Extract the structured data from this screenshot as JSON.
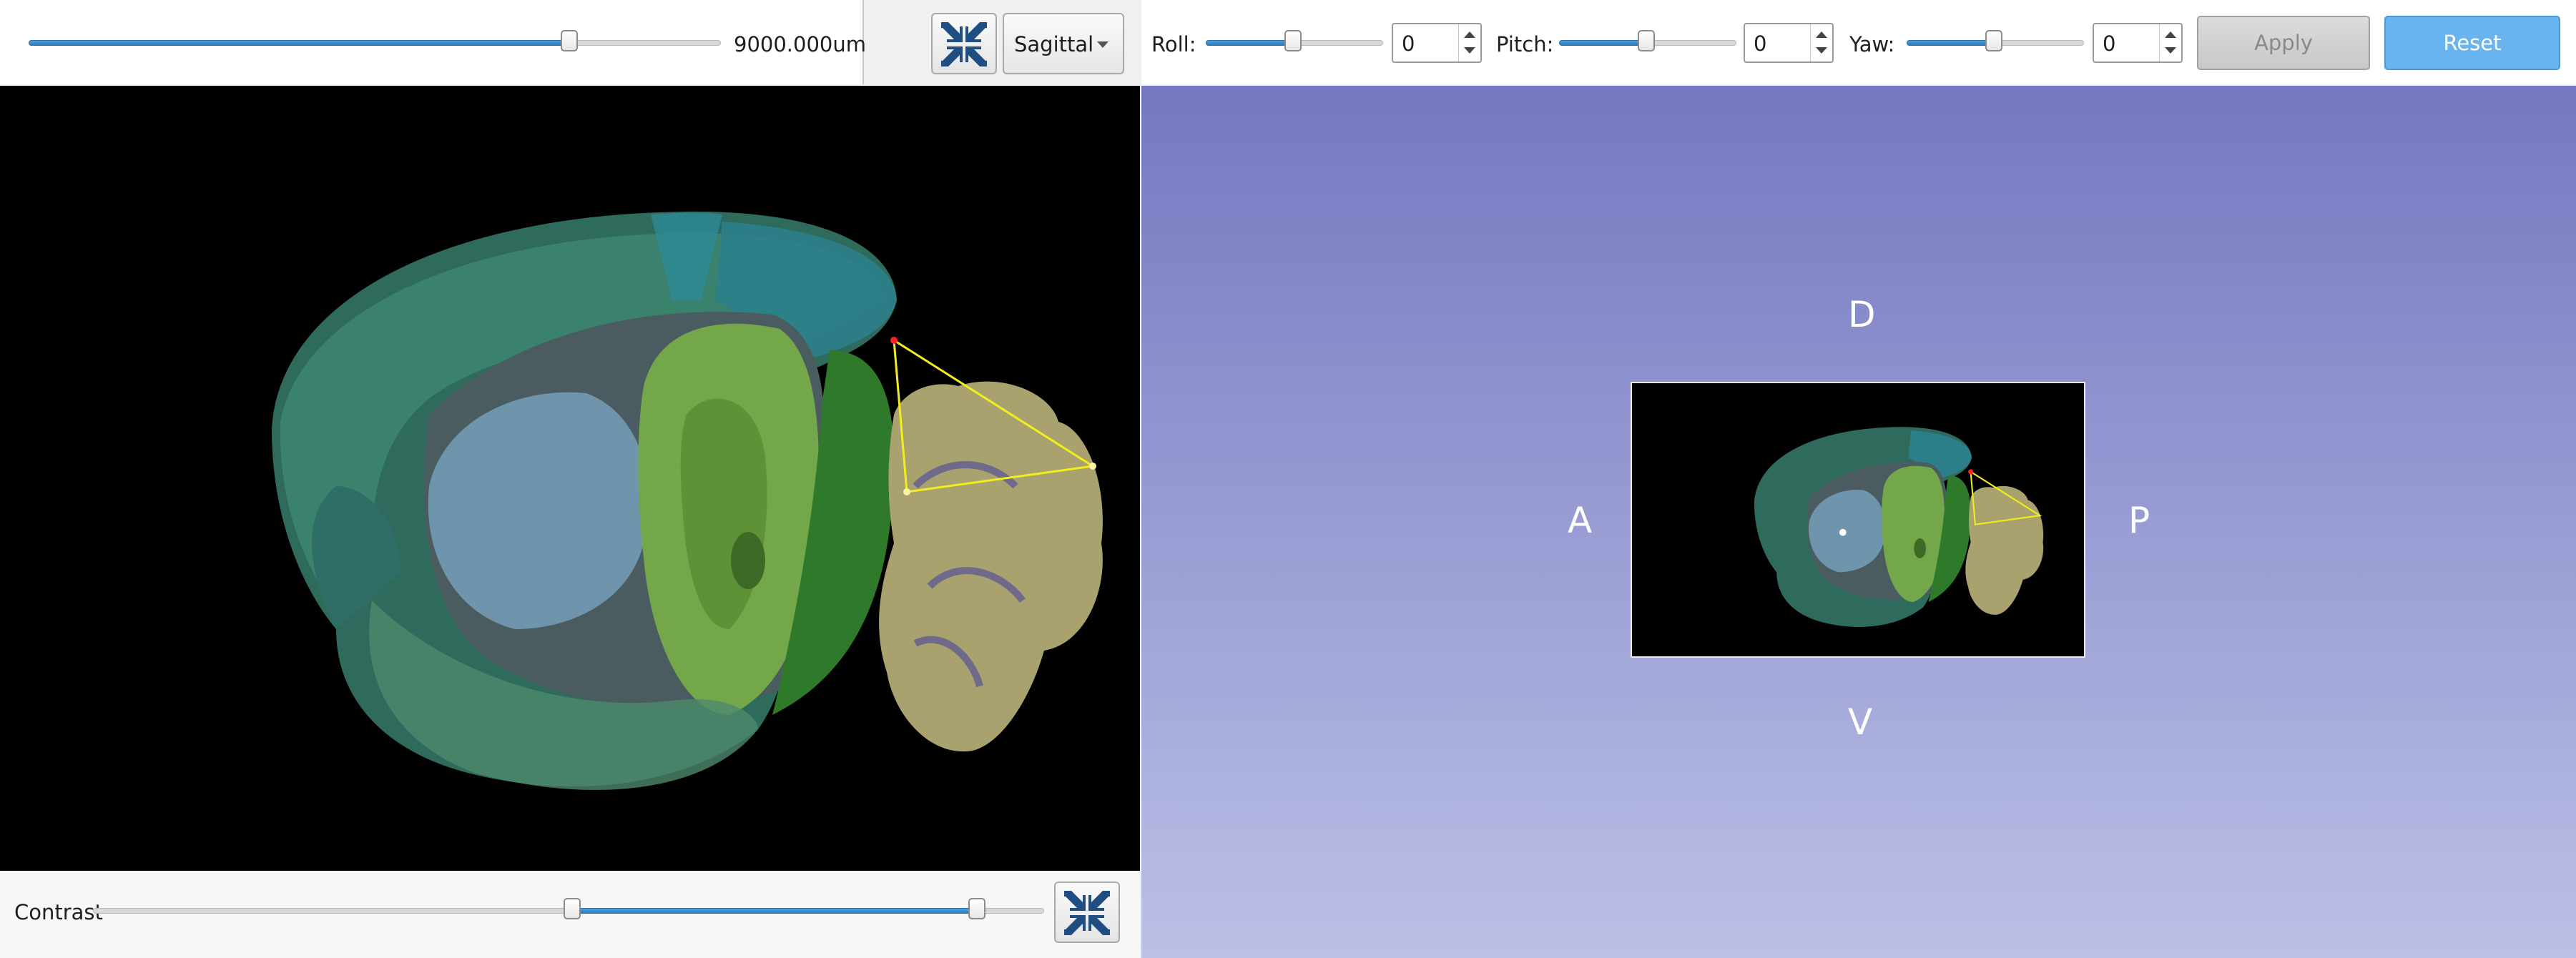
{
  "slice_toolbar": {
    "position_label": "9000.000um",
    "position_fraction": 0.81,
    "view_select": {
      "selected": "Sagittal"
    }
  },
  "rotation_toolbar": {
    "roll": {
      "label": "Roll:",
      "value": "0",
      "slider_fraction": 0.5
    },
    "pitch": {
      "label": "Pitch:",
      "value": "0",
      "slider_fraction": 0.5
    },
    "yaw": {
      "label": "Yaw:",
      "value": "0",
      "slider_fraction": 0.5
    },
    "apply_label": "Apply",
    "reset_label": "Reset"
  },
  "contrast": {
    "label": "Contrast",
    "low_fraction": 0.5,
    "high_fraction": 0.93
  },
  "viewer3d": {
    "orientation": {
      "dorsal": "D",
      "ventral": "V",
      "anterior": "A",
      "posterior": "P"
    }
  },
  "colors": {
    "slider_fill": "#2a7cbf",
    "reset_button": "#69b4ee",
    "annotation_line": "#f2ee1e",
    "annotation_start": "#ff2020",
    "viewport_gradient_top": "#7478c0",
    "viewport_gradient_bottom": "#bcc0e6"
  },
  "icons": {
    "collapse": "collapse-arrows-icon",
    "dropdown": "chevron-down-icon"
  }
}
